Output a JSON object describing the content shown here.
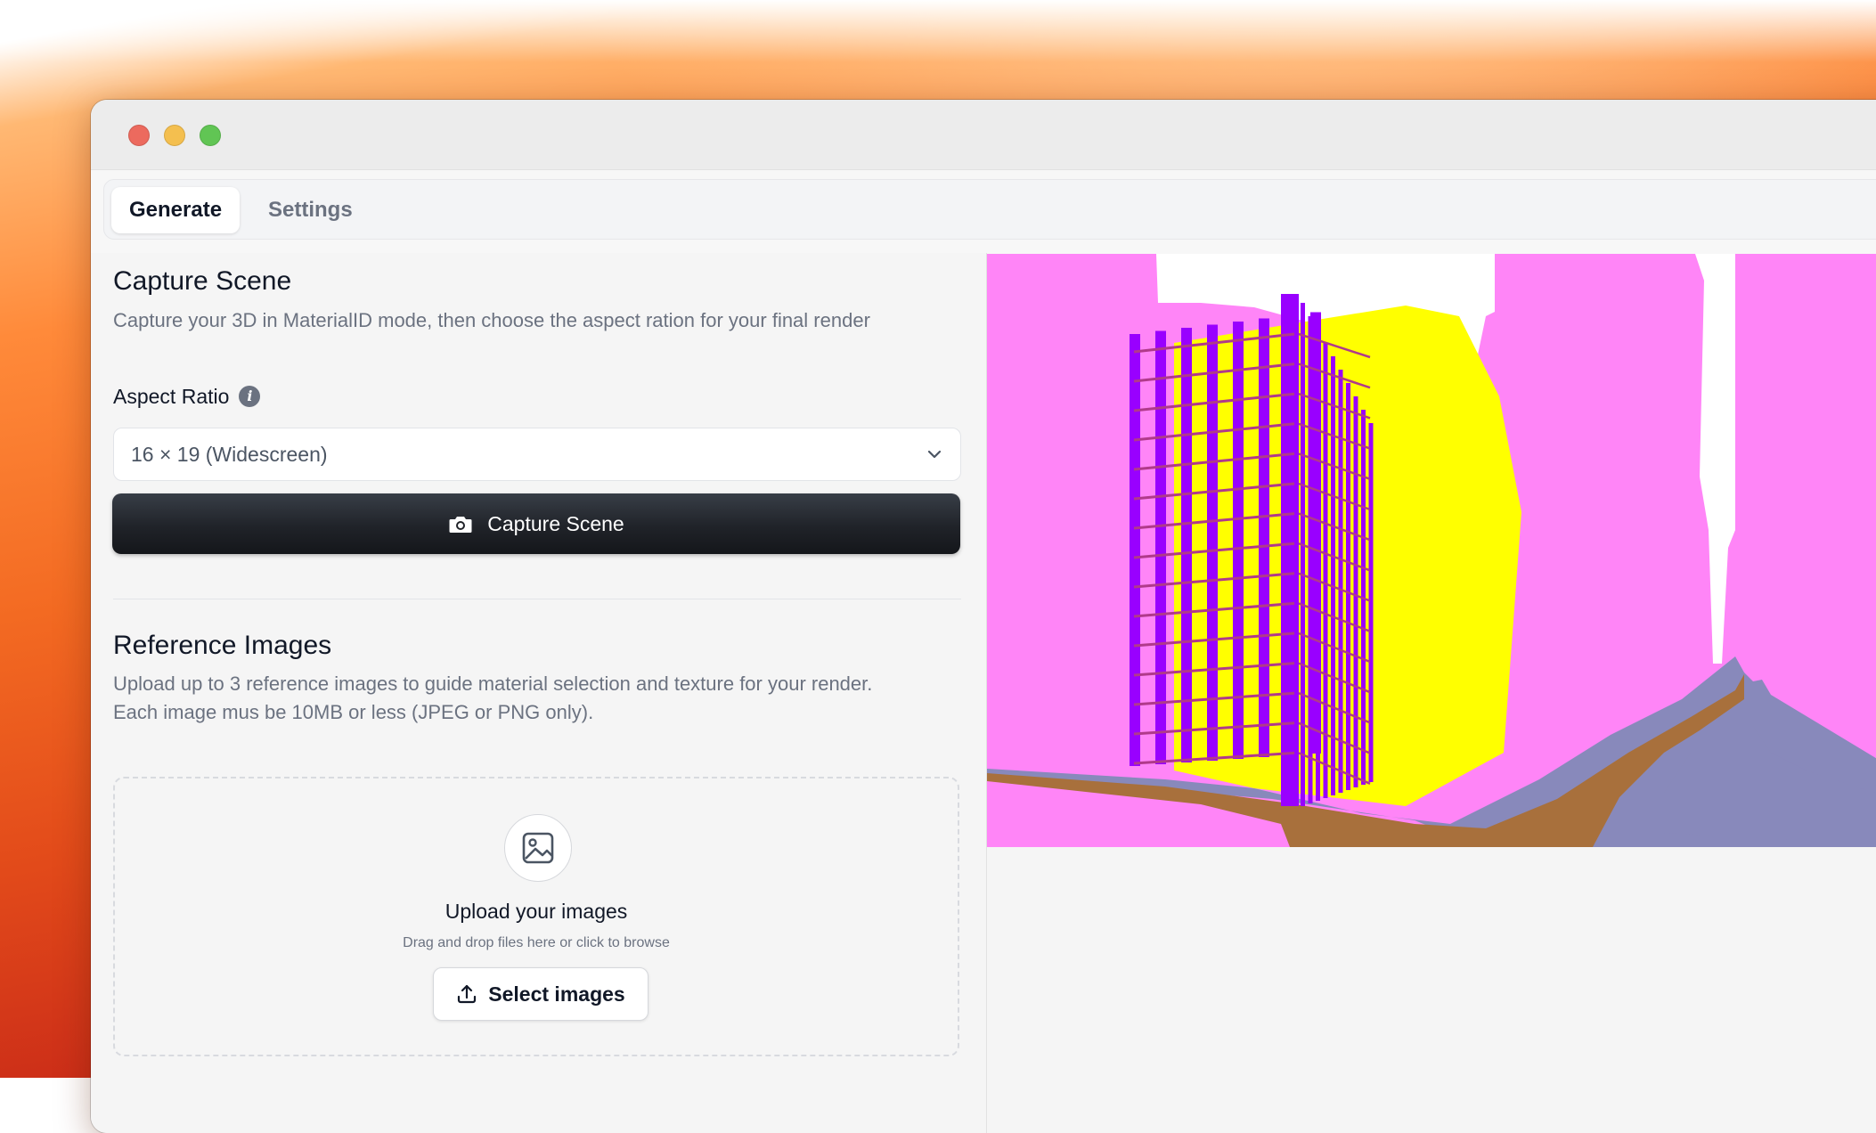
{
  "window": {
    "traffic_lights": [
      "close",
      "minimize",
      "zoom"
    ]
  },
  "tabs": [
    {
      "label": "Generate",
      "active": true
    },
    {
      "label": "Settings",
      "active": false
    }
  ],
  "capture": {
    "title": "Capture Scene",
    "description": "Capture your 3D in MaterialID mode, then choose the aspect ration for your final render",
    "aspect_label": "Aspect Ratio",
    "aspect_value": "16 × 19 (Widescreen)",
    "button_label": "Capture Scene"
  },
  "reference": {
    "title": "Reference Images",
    "description_line1": "Upload up to 3 reference images to guide material selection and texture for your render.",
    "description_line2": "Each image mus be 10MB or less (JPEG or PNG only).",
    "upload_title": "Upload your images",
    "upload_hint": "Drag and drop files here or click to browse",
    "select_button": "Select images"
  },
  "viewport": {
    "colors": {
      "background": "#ff85f7",
      "glass": "#ffff00",
      "mullions": "#9900ff",
      "ground": "#a8703c",
      "pavement": "#8889bb",
      "sky": "#ffffff"
    }
  }
}
